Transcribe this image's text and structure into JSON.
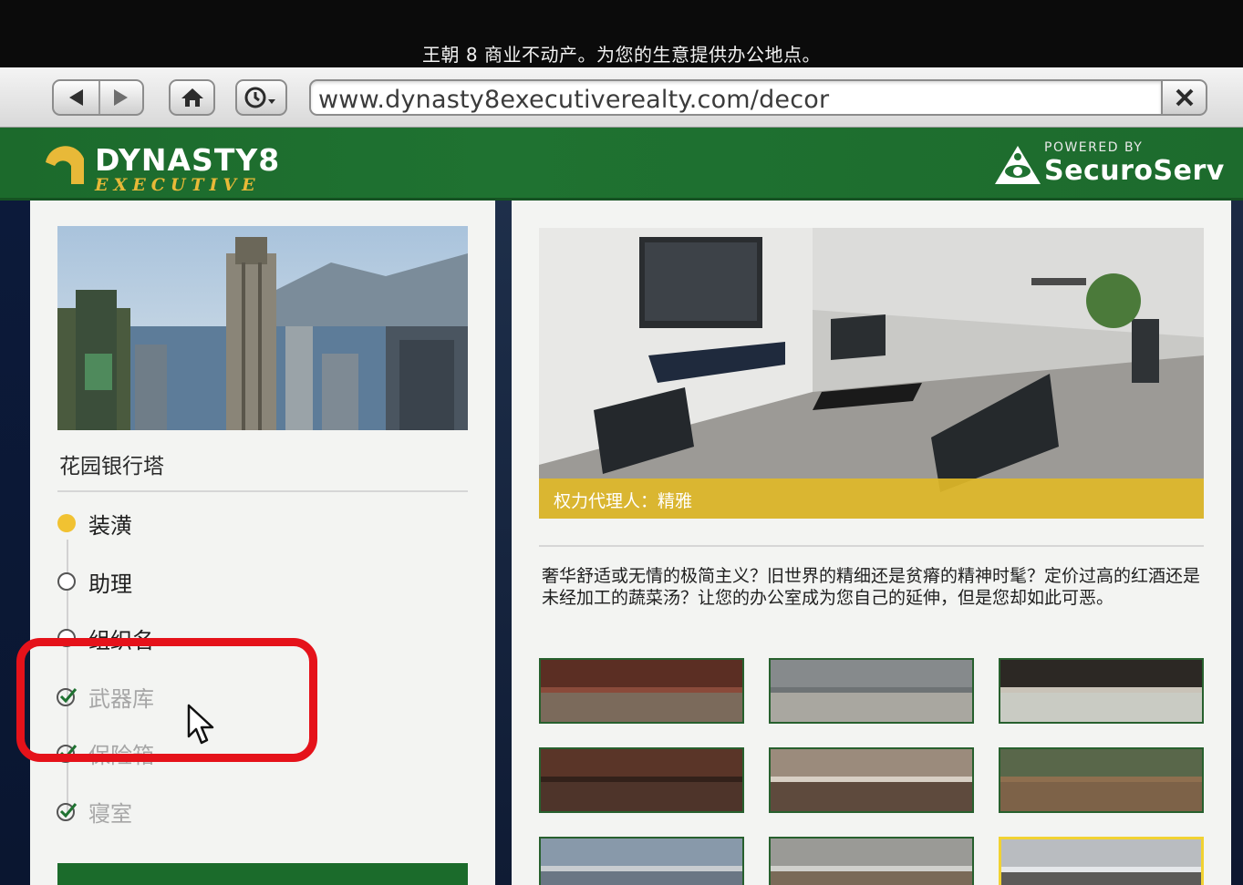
{
  "subtitle": "王朝 8 商业不动产。为您的生意提供办公地点。",
  "browser": {
    "url": "www.dynasty8executiverealty.com/decor"
  },
  "header": {
    "logo_line1": "DYNASTY8",
    "logo_line2": "EXECUTIVE",
    "powered_by": "POWERED BY",
    "partner": "SecuroServ"
  },
  "left": {
    "property_name": "花园银行塔",
    "steps": [
      {
        "label": "装潢",
        "state": "current"
      },
      {
        "label": "助理",
        "state": "todo"
      },
      {
        "label": "组织名",
        "state": "todo"
      },
      {
        "label": "武器库",
        "state": "done"
      },
      {
        "label": "保险箱",
        "state": "done"
      },
      {
        "label": "寝室",
        "state": "done"
      }
    ]
  },
  "right": {
    "image_caption": "权力代理人：精雅",
    "description": "奢华舒适或无情的极简主义？旧世界的精细还是贫瘠的精神时髦？定价过高的红酒还是未经加工的蔬菜汤？让您的办公室成为您自己的延伸，但是您却如此可恶。"
  },
  "colors": {
    "brand_green": "#1f7231",
    "accent_yellow": "#f1c232",
    "highlight_red": "#e5121a"
  },
  "swatches": [
    {
      "top": "#5b2e23",
      "band": "#8a4a3a",
      "bottom": "#7b6a5b",
      "selected": false
    },
    {
      "top": "#868a8c",
      "band": "#6e7375",
      "bottom": "#a9a7a0",
      "selected": false
    },
    {
      "top": "#2c2824",
      "band": "#c9c3b8",
      "bottom": "#c9cbc3",
      "selected": false
    },
    {
      "top": "#5a3528",
      "band": "#33211a",
      "bottom": "#4e342a",
      "selected": false
    },
    {
      "top": "#9b8b7c",
      "band": "#d8cfc4",
      "bottom": "#5e4a3d",
      "selected": false
    },
    {
      "top": "#59674a",
      "band": "#8f6f4f",
      "bottom": "#7d6248",
      "selected": false
    },
    {
      "top": "#8899aa",
      "band": "#c8ccd0",
      "bottom": "#6a7684",
      "selected": false
    },
    {
      "top": "#9a9a96",
      "band": "#d0d0cc",
      "bottom": "#7a6a58",
      "selected": false
    },
    {
      "top": "#b9bcc0",
      "band": "#e5e7ea",
      "bottom": "#5c5a58",
      "selected": true
    }
  ]
}
